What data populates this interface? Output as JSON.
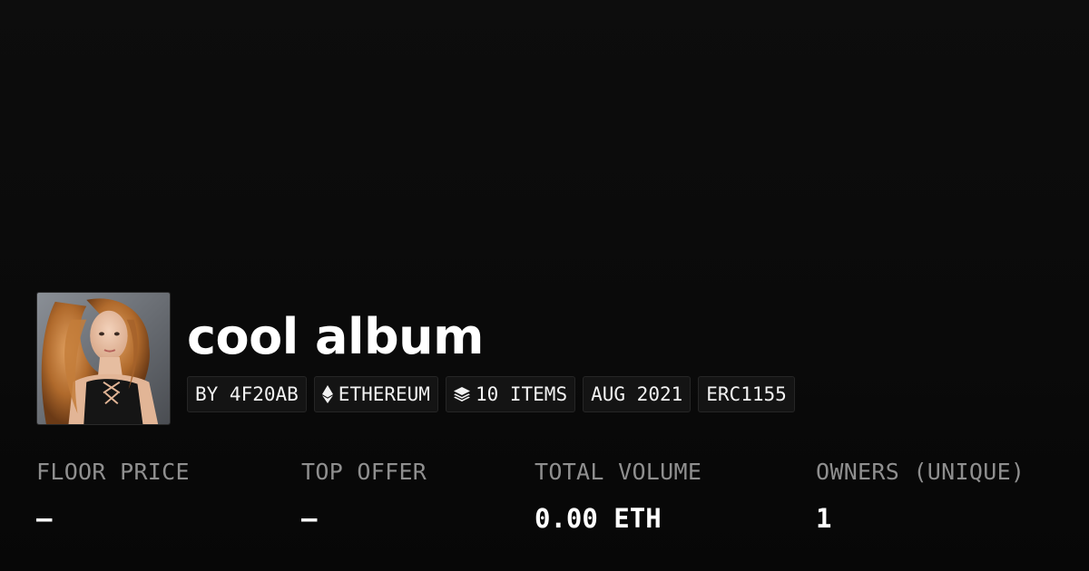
{
  "collection": {
    "title": "cool album",
    "avatar_alt": "collection-avatar"
  },
  "chips": {
    "creator": "BY 4F20AB",
    "chain": "ETHEREUM",
    "chain_icon": "ethereum-icon",
    "items": "10 ITEMS",
    "items_icon": "layers-icon",
    "date": "AUG 2021",
    "standard": "ERC1155"
  },
  "stats": {
    "floor_price": {
      "label": "FLOOR PRICE",
      "value": "—"
    },
    "top_offer": {
      "label": "TOP OFFER",
      "value": "—"
    },
    "total_volume": {
      "label": "TOTAL VOLUME",
      "value": "0.00 ETH"
    },
    "owners": {
      "label": "OWNERS (UNIQUE)",
      "value": "1"
    }
  },
  "colors": {
    "background": "#0a0a0a",
    "text_primary": "#ffffff",
    "text_muted": "#8f8f8f",
    "chip_bg": "#141414",
    "chip_border": "#262626"
  }
}
